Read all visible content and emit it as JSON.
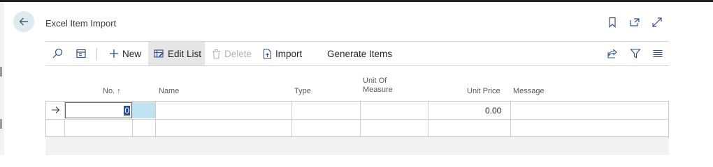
{
  "page": {
    "title": "Excel Item Import"
  },
  "actions": {
    "new": "New",
    "edit_list": "Edit List",
    "delete": "Delete",
    "import": "Import",
    "generate_items": "Generate Items"
  },
  "columns": {
    "no": "No. ↑",
    "name": "Name",
    "type": "Type",
    "unit_of_measure_line1": "Unit Of",
    "unit_of_measure_line2": "Measure",
    "unit_price": "Unit Price",
    "message": "Message"
  },
  "rows": [
    {
      "no": "0",
      "name": "",
      "type": "",
      "unit_of_measure": "",
      "unit_price": "0.00",
      "message": ""
    }
  ],
  "icons": {
    "back": "arrow-left-icon",
    "bookmark": "bookmark-icon",
    "open_new": "open-in-new-window-icon",
    "expand": "expand-icon",
    "search": "search-icon",
    "layout": "page-layout-icon",
    "share": "share-icon",
    "filter": "filter-icon",
    "list": "list-options-icon",
    "row_marker": "arrow-right-icon"
  },
  "colors": {
    "accent": "#2b4f9a",
    "back_button_bg": "#dfeaf0",
    "selected_cell": "#c0e3f0"
  }
}
